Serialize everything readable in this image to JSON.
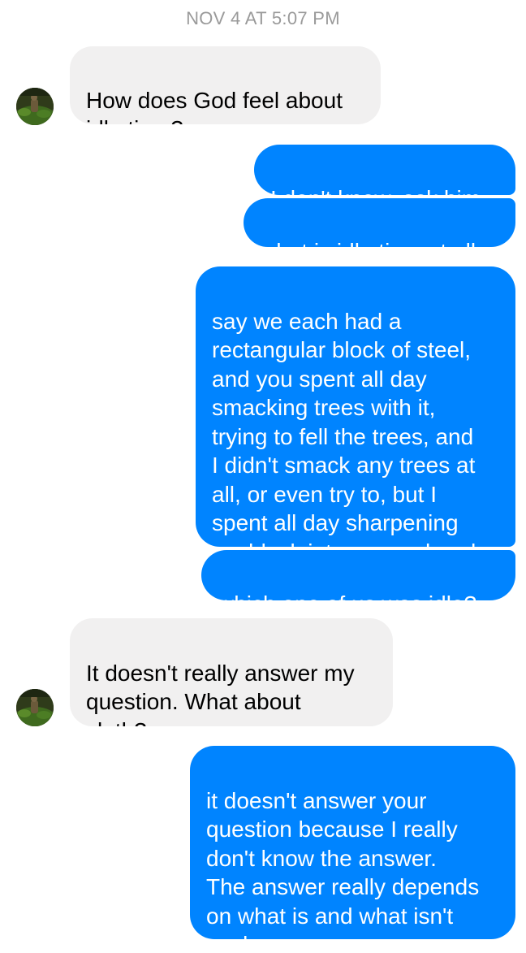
{
  "timestamp": "NOV 4 AT 5:07 PM",
  "messages": [
    {
      "sender": "contact",
      "text": "How does God feel about\nidle time?"
    },
    {
      "sender": "me",
      "text": "I don't know, ask him"
    },
    {
      "sender": "me",
      "text": "what is idle time at all"
    },
    {
      "sender": "me",
      "text": "say we each had a\nrectangular block of steel,\nand you spent all day\nsmacking trees with it,\ntrying to fell the trees, and\nI didn't smack any trees at\nall, or even try to, but I\nspent all day sharpening\nmy block into an axe head"
    },
    {
      "sender": "me",
      "text": "which one of us was idle?"
    },
    {
      "sender": "contact",
      "text": "It doesn't really answer my\nquestion. What about\nsloth?"
    },
    {
      "sender": "me",
      "text": "it doesn't answer your\nquestion because I really\ndon't know the answer.\nThe answer really depends\non what is and what isn't\nwork"
    }
  ],
  "colors": {
    "outgoing_bubble": "#0084ff",
    "incoming_bubble": "#f1f0f0",
    "timestamp_text": "#9a9a9a"
  },
  "icons": {
    "avatar": "contact-avatar-photo"
  }
}
